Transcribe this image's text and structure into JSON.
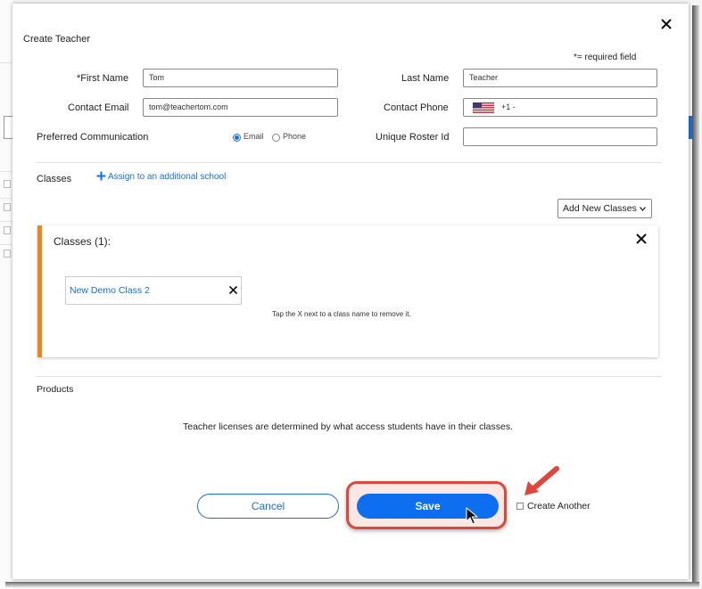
{
  "modal": {
    "title": "Create Teacher",
    "required_note": "*= required field"
  },
  "form": {
    "first_name": {
      "label": "*First Name",
      "value": "Tom"
    },
    "last_name": {
      "label": "Last Name",
      "value": "Teacher"
    },
    "contact_email": {
      "label": "Contact Email",
      "value": "tom@teachertom.com"
    },
    "contact_phone": {
      "label": "Contact Phone",
      "country_code": "+1 -",
      "flag": "us-flag-icon"
    },
    "preferred_communication": {
      "label": "Preferred Communication",
      "options": [
        {
          "label": "Email",
          "selected": true
        },
        {
          "label": "Phone",
          "selected": false
        }
      ]
    },
    "unique_roster_id": {
      "label": "Unique Roster Id",
      "value": ""
    }
  },
  "classes": {
    "label": "Classes",
    "assign_link": "Assign to an additional school",
    "add_new_classes": "Add New Classes",
    "panel_title": "Classes (1):",
    "items": [
      {
        "name": "New Demo Class 2"
      }
    ],
    "remove_hint": "Tap the X next to a class name to remove it."
  },
  "products": {
    "label": "Products",
    "note": "Teacher licenses are determined by what access students have in their classes."
  },
  "footer": {
    "cancel_label": "Cancel",
    "save_label": "Save",
    "create_another_label": "Create Another"
  },
  "colors": {
    "accent": "#1a6fd6",
    "save_button": "#0d6ff0",
    "panel_border": "#e8881f",
    "highlight": "#e0463a"
  }
}
